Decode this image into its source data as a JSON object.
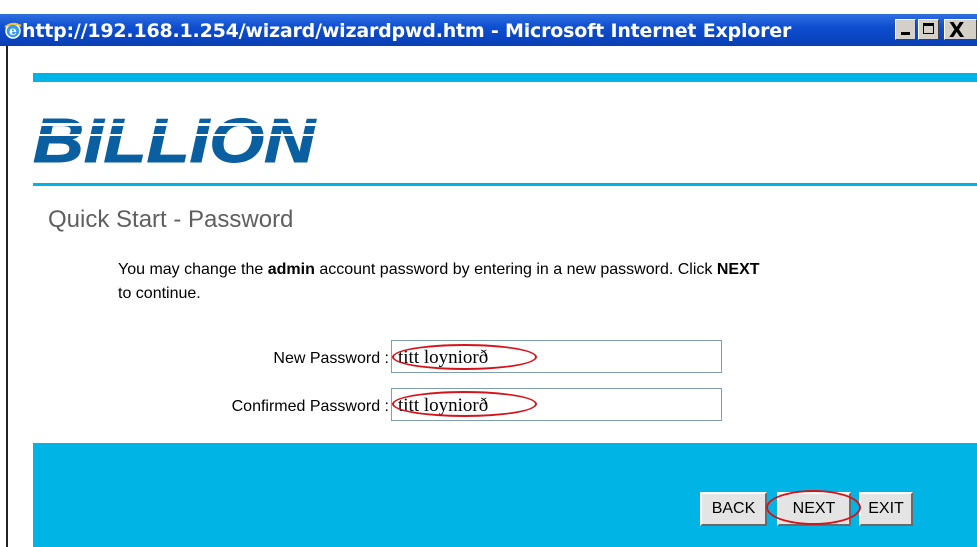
{
  "window": {
    "title": "http://192.168.1.254/wizard/wizardpwd.htm - Microsoft Internet Explorer",
    "controls": {
      "minimize": "_",
      "maximize": "",
      "close": "X"
    }
  },
  "branding": {
    "logo_text": "BILLION",
    "accent_color": "#00b5e6"
  },
  "page": {
    "title": "Quick Start - Password",
    "desc_part1": "You may change the ",
    "desc_bold1": "admin",
    "desc_part2": " account password by entering in a new password. Click ",
    "desc_bold2": "NEXT",
    "desc_part3": " to continue."
  },
  "form": {
    "new_password_label": "New Password :",
    "new_password_value": "titt loyniorð",
    "confirm_password_label": "Confirmed Password :",
    "confirm_password_value": "titt loyniorð"
  },
  "buttons": {
    "back": "BACK",
    "next": "NEXT",
    "exit": "EXIT"
  }
}
